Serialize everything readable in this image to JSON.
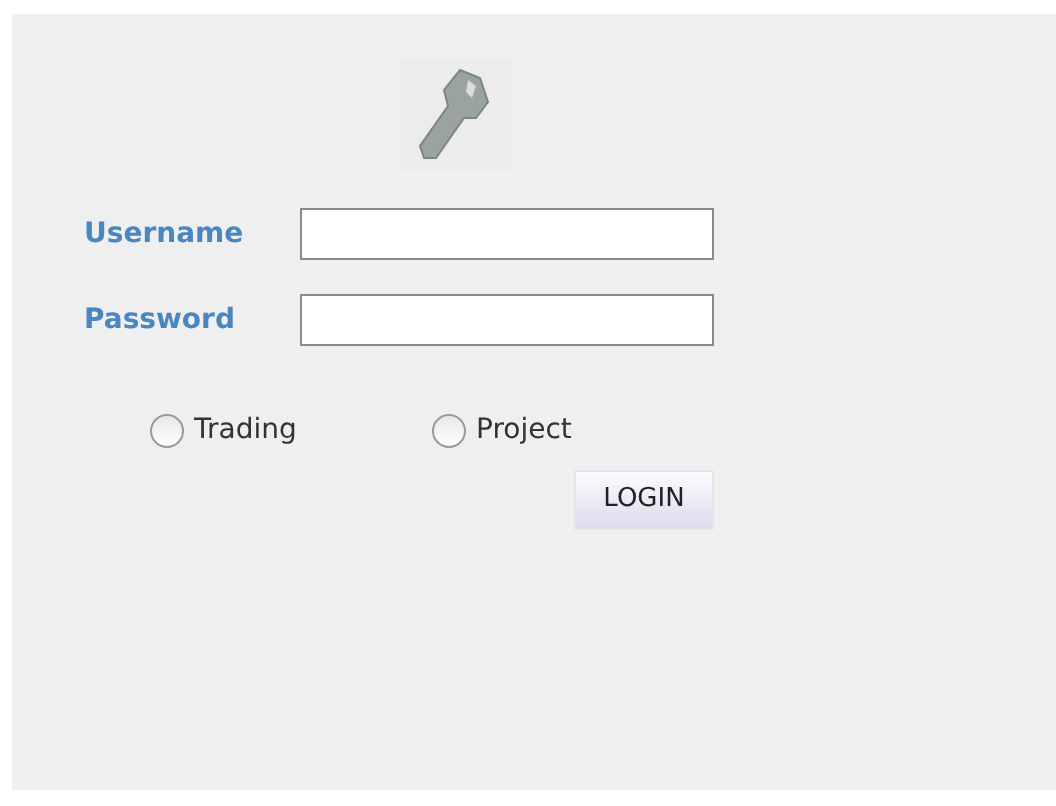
{
  "fields": [
    {
      "label": "Username"
    },
    {
      "label": "Password"
    }
  ],
  "account_types": [
    {
      "label": "Trading",
      "selected": false
    },
    {
      "label": "Project",
      "selected": false
    }
  ],
  "login_button": "LOGIN"
}
